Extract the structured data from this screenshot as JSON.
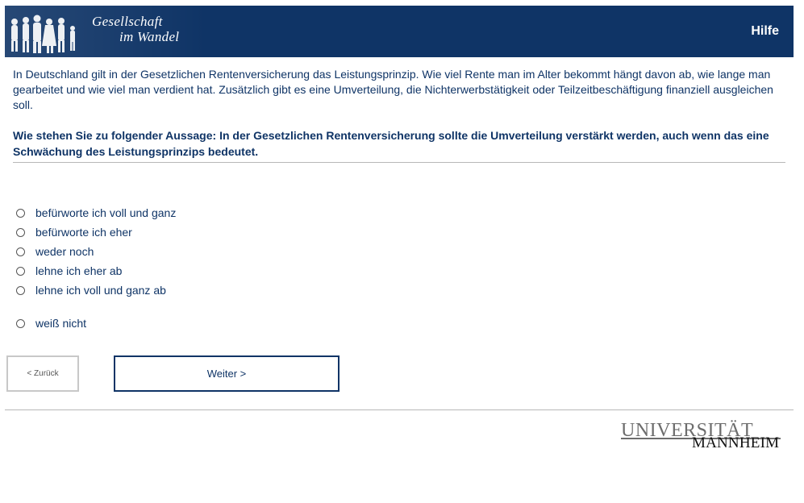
{
  "header": {
    "logo_line1": "Gesellschaft",
    "logo_line2": "im Wandel",
    "help_label": "Hilfe",
    "bg_color": "#0f3466"
  },
  "intro_text": "In Deutschland gilt in der Gesetzlichen Rentenversicherung das Leistungsprinzip. Wie viel Rente man im Alter bekommt hängt davon ab, wie lange man gearbeitet und wie viel man verdient hat. Zusätzlich gibt es eine Umverteilung, die Nichterwerbstätigkeit oder Teilzeitbeschäftigung finanziell ausgleichen soll.",
  "question_text": "Wie stehen Sie zu folgender Aussage: In der Gesetzlichen Rentenversicherung sollte die Umverteilung verstärkt werden, auch wenn das eine Schwächung des Leistungsprinzips bedeutet.",
  "options": [
    {
      "label": "befürworte ich voll und ganz",
      "selected": false
    },
    {
      "label": "befürworte ich eher",
      "selected": false
    },
    {
      "label": "weder noch",
      "selected": false
    },
    {
      "label": "lehne ich eher ab",
      "selected": false
    },
    {
      "label": "lehne ich voll und ganz ab",
      "selected": false
    },
    {
      "label": "weiß nicht",
      "selected": false
    }
  ],
  "nav": {
    "back_label": "< Zurück",
    "next_label": "Weiter >"
  },
  "footer": {
    "uni_line1": "UNIVERSITÄT",
    "uni_line2": "MANNHEIM"
  }
}
